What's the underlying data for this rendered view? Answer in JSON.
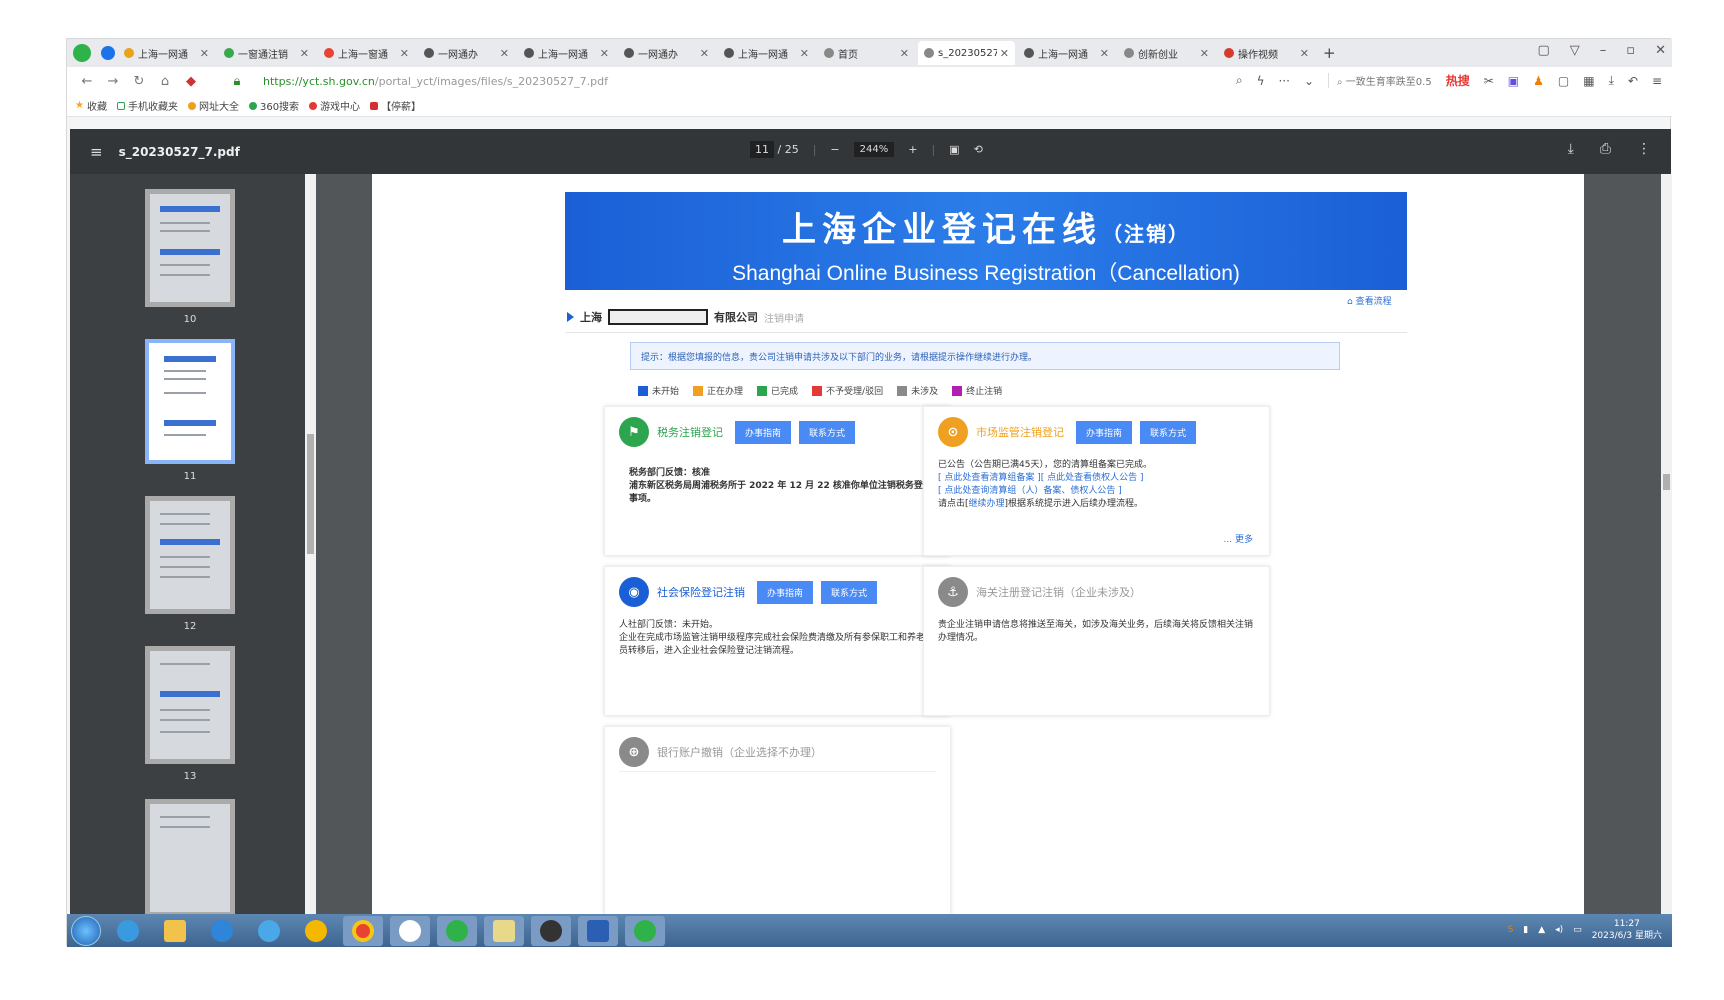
{
  "browser": {
    "tabs": [
      {
        "title": "上海一网通",
        "color": "#e8a319"
      },
      {
        "title": "一窗通注销",
        "color": "#3aa74b"
      },
      {
        "title": "上海一窗通",
        "color": "#e84332"
      },
      {
        "title": "一网通办",
        "color": "#555555"
      },
      {
        "title": "上海一网通",
        "color": "#555555"
      },
      {
        "title": "一网通办",
        "color": "#555555"
      },
      {
        "title": "上海一网通",
        "color": "#555555"
      },
      {
        "title": "首页",
        "color": "#888888"
      },
      {
        "title": "s_20230527",
        "color": "#888888",
        "active": true
      },
      {
        "title": "上海一网通",
        "color": "#555555"
      },
      {
        "title": "创新创业",
        "color": "#888888"
      },
      {
        "title": "操作视频",
        "color": "#d33b2c"
      }
    ],
    "new_tab": "+",
    "url_host": "https://yct.sh.gov.cn",
    "url_path": "/portal_yct/images/files/s_20230527_7.pdf",
    "search_text": "一致生育率跌至0.5",
    "hot_label": "热搜",
    "bookmarks": [
      "收藏",
      "手机收藏夹",
      "网址大全",
      "360搜索",
      "游戏中心",
      "【停薪】"
    ]
  },
  "pdf": {
    "filename": "s_20230527_7.pdf",
    "page_current": "11",
    "page_total": "/ 25",
    "zoom": "244%",
    "thumbnails": [
      "10",
      "11",
      "12",
      "13"
    ]
  },
  "doc": {
    "banner_title": "上海企业登记在线",
    "banner_title_suffix": "（注销）",
    "banner_subtitle": "Shanghai Online Business Registration（Cancellation)",
    "view_flow": "查看流程",
    "company_prefix": "上海",
    "company_suffix": "有限公司",
    "company_sub": "注销申请",
    "notice": "提示：根据您填报的信息，贵公司注销申请共涉及以下部门的业务，请根据提示操作继续进行办理。",
    "legend": [
      {
        "label": "未开始",
        "color": "#1b5fd6"
      },
      {
        "label": "正在办理",
        "color": "#f0a020"
      },
      {
        "label": "已完成",
        "color": "#2da44e"
      },
      {
        "label": "不予受理/驳回",
        "color": "#e53935"
      },
      {
        "label": "未涉及",
        "color": "#8a8a8a"
      },
      {
        "label": "终止注销",
        "color": "#b01fb0"
      }
    ],
    "cards": {
      "tax": {
        "title": "税务注销登记",
        "color": "#2da44e",
        "btn1": "办事指南",
        "btn2": "联系方式",
        "body1": "税务部门反馈：核准",
        "body2": "浦东新区税务局周浦税务所于 2022 年 12 月 22 核准你单位注销税务登记事项。"
      },
      "market": {
        "title": "市场监管注销登记",
        "color": "#f0a020",
        "btn1": "办事指南",
        "btn2": "联系方式",
        "body1": "已公告（公告期已满45天），您的清算组备案已完成。",
        "link1": "[ 点此处查看清算组备案 ]",
        "link2": "[ 点此处查看债权人公告 ]",
        "link3": "[ 点此处查询清算组（人）备案、债权人公告 ]",
        "body2a": "请点击[",
        "link4": "继续办理",
        "body2b": "]根据系统提示进入后续办理流程。",
        "more": "... 更多"
      },
      "social": {
        "title": "社会保险登记注销",
        "color": "#1b5fd6",
        "btn1": "办事指南",
        "btn2": "联系方式",
        "body1": "人社部门反馈：未开始。",
        "body2": "企业在完成市场监管注销甲级程序完成社会保险费清缴及所有参保职工和养老人员转移后，进入企业社会保险登记注销流程。"
      },
      "customs": {
        "title": "海关注册登记注销（企业未涉及）",
        "color": "#8a8a8a",
        "body": "贵企业注销申请信息将推送至海关，如涉及海关业务，后续海关将反馈相关注销办理情况。"
      },
      "bank": {
        "title": "银行账户撤销（企业选择不办理）",
        "color": "#8a8a8a"
      }
    }
  },
  "taskbar": {
    "time": "11:27",
    "date": "2023/6/3 星期六"
  }
}
